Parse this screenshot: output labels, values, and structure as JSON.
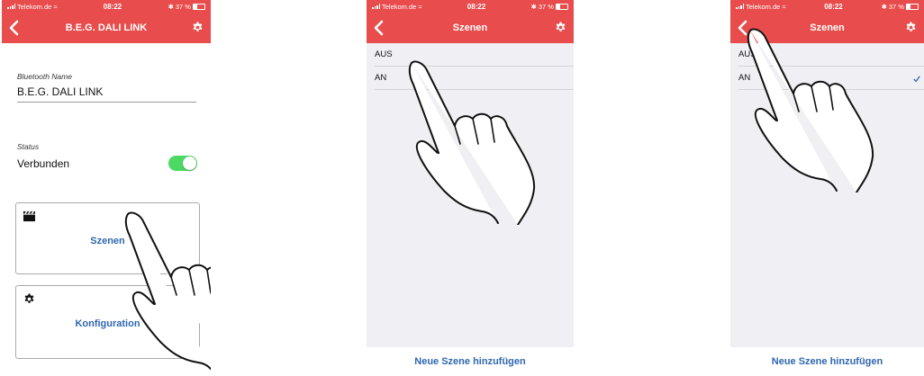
{
  "status_bar": {
    "carrier": "Telekom.de",
    "time": "08:22",
    "battery": "37 %"
  },
  "screen1": {
    "title": "B.E.G. DALI LINK",
    "bluetooth_label": "Bluetooth Name",
    "bluetooth_value": "B.E.G. DALI LINK",
    "status_label": "Status",
    "status_value": "Verbunden",
    "connected": true,
    "tiles": [
      {
        "label": "Szenen",
        "icon": "clapperboard-icon"
      },
      {
        "label": "Konfiguration",
        "icon": "gear-icon"
      }
    ]
  },
  "screen2": {
    "title": "Szenen",
    "scenes": [
      "AUS",
      "AN"
    ],
    "footer": "Neue Szene hinzufügen"
  },
  "screen3": {
    "title": "Szenen",
    "scenes": [
      "AUS",
      "AN"
    ],
    "selected_scene": "AN",
    "footer": "Neue Szene hinzufügen"
  },
  "colors": {
    "header": "#e84c4c",
    "accent": "#2f67b0",
    "toggle_on": "#4cd964",
    "list_background": "#efeff4"
  }
}
